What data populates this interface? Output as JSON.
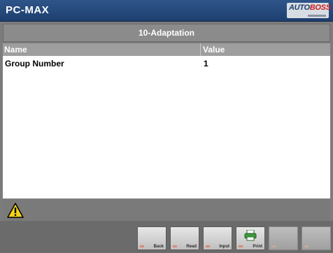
{
  "app": {
    "title": "PC-MAX",
    "brand_main": "AUTO",
    "brand_accent": "BOSS"
  },
  "screen": {
    "title": "10-Adaptation"
  },
  "table": {
    "columns": [
      "Name",
      "Value"
    ],
    "rows": [
      {
        "name": "Group Number",
        "value": "1"
      }
    ]
  },
  "status": {
    "icon": "warning-icon"
  },
  "toolbar": {
    "buttons": [
      {
        "label": "Back",
        "enabled": true
      },
      {
        "label": "Read",
        "enabled": true
      },
      {
        "label": "Input",
        "enabled": true
      },
      {
        "label": "Print",
        "enabled": true,
        "icon": "printer-icon"
      },
      {
        "label": "",
        "enabled": false
      },
      {
        "label": "",
        "enabled": false
      }
    ]
  },
  "colors": {
    "titlebar": "#2e5589",
    "accent": "#cc1f1f"
  }
}
